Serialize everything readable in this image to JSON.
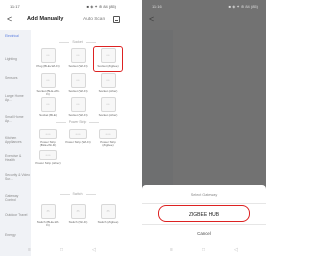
{
  "left": {
    "status_time": "11:17",
    "status_icons": "■ ◈ ✦ ⊛ 84 (85)",
    "back": "<",
    "title": "Add Manually",
    "auto_scan": "Auto Scan",
    "categories": [
      {
        "label": "Electrical",
        "active": true
      },
      {
        "label": "Lighting"
      },
      {
        "label": "Sensors"
      },
      {
        "label": "Large Home Ap..."
      },
      {
        "label": "Small Home Ap..."
      },
      {
        "label": "Kitchen Appliances"
      },
      {
        "label": "Exercise & Health"
      },
      {
        "label": "Security & Video Sur..."
      },
      {
        "label": "Gateway Control"
      },
      {
        "label": "Outdoor Travel"
      },
      {
        "label": "Energy"
      }
    ],
    "sections": {
      "socket": "Socket",
      "power_strip": "Power Strip",
      "switch": "Switch"
    },
    "socket_devices": [
      {
        "label": "Plug (BLE+Wi-Fi)"
      },
      {
        "label": "Socket (Wi-Fi)"
      },
      {
        "label": "Socket (Zigbee)"
      },
      {
        "label": "Socket (BLE+Wi-Fi)"
      },
      {
        "label": "Socket (Wi-Fi)"
      },
      {
        "label": "Socket (other)"
      },
      {
        "label": "Socket (BLE)"
      },
      {
        "label": "Socket (Wi-Fi)"
      },
      {
        "label": "Socket (other)"
      }
    ],
    "strip_devices": [
      {
        "label": "Power Strip (BLE+Wi-Fi)"
      },
      {
        "label": "Power Strip (Wi-Fi)"
      },
      {
        "label": "Power Strip (Zigbee)"
      },
      {
        "label": "Power Strip (other)"
      }
    ],
    "switch_devices": [
      {
        "label": "Switch (BLE+Wi-Fi)"
      },
      {
        "label": "Switch (Wi-Fi)"
      },
      {
        "label": "Switch (Zigbee)"
      }
    ],
    "nav": [
      "≡",
      "□",
      "◁"
    ]
  },
  "right": {
    "status_time": "11:16",
    "status_icons": "■ ◈ ✦ ⊛ 84 (85)",
    "sheet_title": "Select Gateway",
    "option": "ZIGBEE HUB",
    "cancel": "Cancel",
    "nav": [
      "≡",
      "□",
      "◁"
    ]
  },
  "colors": {
    "accent": "#5a7ee0",
    "highlight": "#dd2222"
  }
}
